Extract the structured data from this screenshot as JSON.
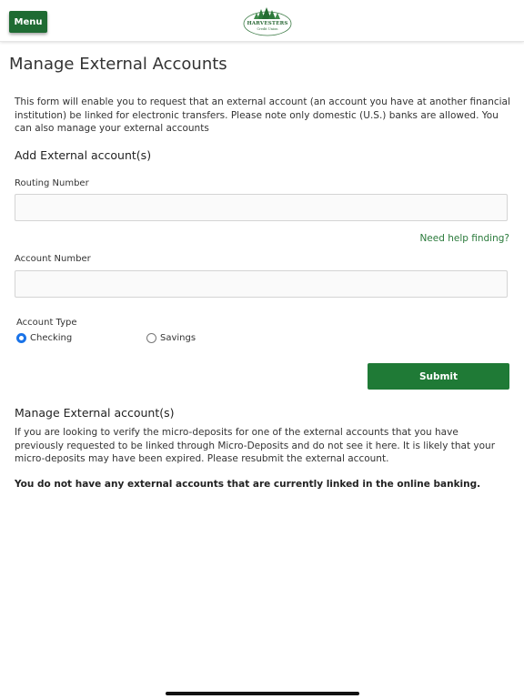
{
  "header": {
    "menu_label": "Menu",
    "logo": {
      "name": "HARVESTERS",
      "tagline": "Credit Union",
      "icon": "pine-trees-logo",
      "color": "#2e6b3a"
    }
  },
  "page": {
    "title": "Manage External Accounts",
    "intro": "This form will enable you to request that an external account (an account you have at another financial institution) be linked for electronic transfers. Please note only domestic (U.S.) banks are allowed. You can also manage your external accounts"
  },
  "add_section": {
    "heading": "Add External account(s)",
    "routing_label": "Routing Number",
    "routing_value": "",
    "help_link": "Need help finding?",
    "account_label": "Account Number",
    "account_value": "",
    "account_type_label": "Account Type",
    "account_types": [
      {
        "label": "Checking",
        "selected": true
      },
      {
        "label": "Savings",
        "selected": false
      }
    ],
    "submit_label": "Submit"
  },
  "manage_section": {
    "heading": "Manage External account(s)",
    "text": "If you are looking to verify the micro-deposits for one of the external accounts that you have previously requested to be linked through Micro-Deposits and do not see it here. It is likely that your micro-deposits may have been expired. Please resubmit the external account.",
    "no_accounts": "You do not have any external accounts that are currently linked in the online banking."
  },
  "colors": {
    "brand_green": "#1f7a36",
    "link_green": "#2a7a3b",
    "radio_selected": "#1a73e8"
  }
}
